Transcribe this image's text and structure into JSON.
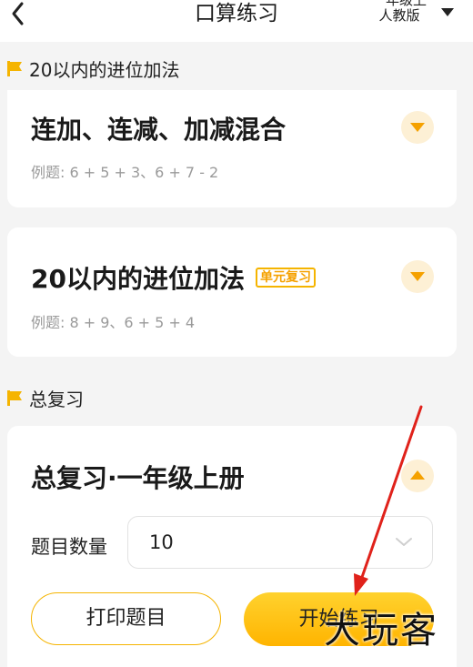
{
  "header": {
    "back_icon": "chevron-left-icon",
    "title": "口算练习",
    "grade_line1": "一年级上",
    "grade_line2": "人教版",
    "grade_dropdown_icon": "caret-down-icon"
  },
  "sections": [
    {
      "label": "20以内的进位加法",
      "icon": "flag-icon"
    },
    {
      "label": "总复习",
      "icon": "flag-icon"
    }
  ],
  "cards": [
    {
      "title": "连加、连减、加减混合",
      "example": "例题: 6 + 5 + 3、6 + 7 - 2",
      "expand_icon": "caret-down-icon"
    },
    {
      "title": "20以内的进位加法",
      "badge": "单元复习",
      "example": "例题: 8 + 9、6 + 5 + 4",
      "expand_icon": "caret-down-icon"
    },
    {
      "title": "总复习·一年级上册",
      "collapse_icon": "caret-up-icon",
      "quantity_label": "题目数量",
      "quantity_value": "10",
      "quantity_dropdown_icon": "chevron-down-icon",
      "print_button": "打印题目",
      "start_button": "开始练习"
    }
  ],
  "watermark": "大玩客",
  "colors": {
    "accent": "#f5a100",
    "accent_bg": "#fdf0d5",
    "button_gradient_top": "#ffd22e",
    "button_gradient_bottom": "#ffb400",
    "annotation_arrow": "#e0221b",
    "page_bg": "#f4f4f4"
  }
}
